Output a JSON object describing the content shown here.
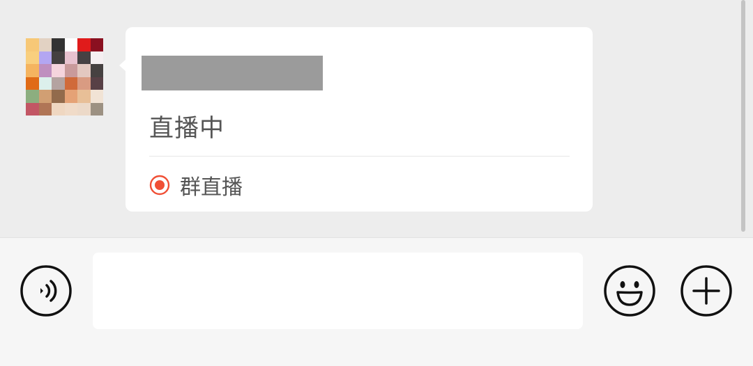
{
  "chat": {
    "message": {
      "status": "直播中",
      "source_label": "群直播"
    }
  },
  "input_bar": {
    "text_value": ""
  },
  "icons": {
    "voice": "voice-icon",
    "emoji": "emoji-icon",
    "plus": "plus-icon",
    "live": "live-record-icon"
  },
  "colors": {
    "live_accent": "#f04f35",
    "chat_background": "#ededed",
    "input_background": "#f6f6f6",
    "bubble_background": "#ffffff"
  }
}
